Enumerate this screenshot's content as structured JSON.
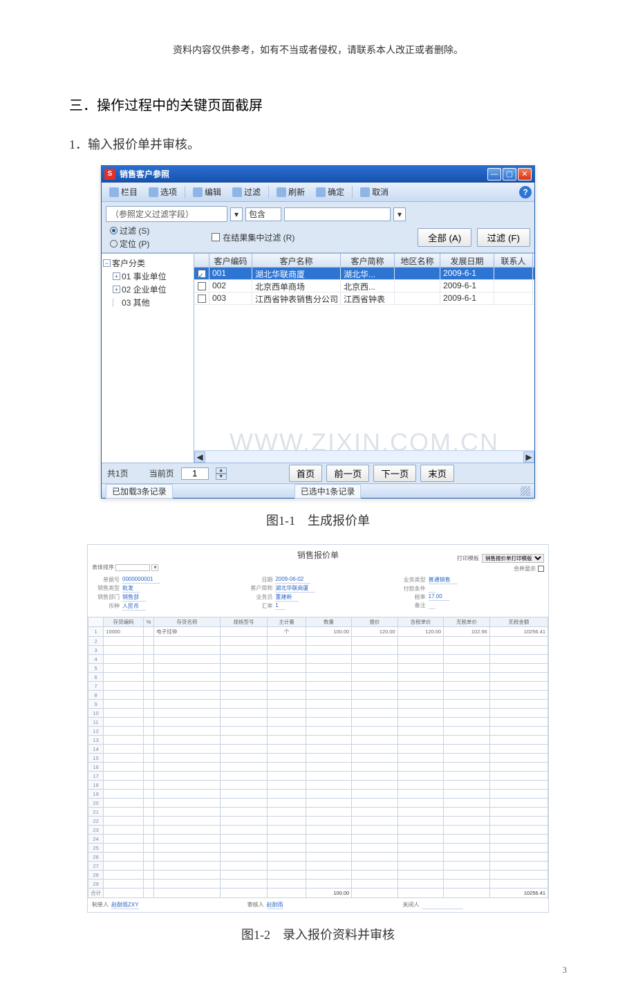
{
  "page": {
    "disclaimer": "资料内容仅供参考，如有不当或者侵权，请联系本人改正或者删除。",
    "section_title": "三．操作过程中的关键页面截屏",
    "subsection": "1．输入报价单并审核。",
    "caption1": "图1-1　生成报价单",
    "caption2": "图1-2　录入报价资料并审核",
    "page_number": "3",
    "watermark": "WWW.ZIXIN.COM.CN"
  },
  "window1": {
    "title": "销售客户参照",
    "toolbar": {
      "columns": "栏目",
      "options": "选项",
      "edit": "编辑",
      "filter": "过滤",
      "refresh": "刷新",
      "confirm": "确定",
      "cancel": "取消"
    },
    "filterbar": {
      "field_placeholder": "（参照定义过滤字段）",
      "contains": "包含",
      "in_results": "在结果集中过滤 (R)",
      "radio_filter": "过滤 (S)",
      "radio_locate": "定位 (P)",
      "btn_all": "全部 (A)",
      "btn_filter": "过滤 (F)"
    },
    "tree": {
      "root": "客户分类",
      "n1": "01 事业单位",
      "n2": "02 企业单位",
      "n3": "03 其他"
    },
    "grid": {
      "h_code": "客户编码",
      "h_name": "客户名称",
      "h_short": "客户简称",
      "h_region": "地区名称",
      "h_date": "发展日期",
      "h_contact": "联系人",
      "rows": [
        {
          "chk": true,
          "code": "001",
          "name": "湖北华联商厦",
          "short": "湖北华...",
          "region": "",
          "date": "2009-6-1",
          "contact": ""
        },
        {
          "chk": false,
          "code": "002",
          "name": "北京西单商场",
          "short": "北京西...",
          "region": "",
          "date": "2009-6-1",
          "contact": ""
        },
        {
          "chk": false,
          "code": "003",
          "name": "江西省钟表销售分公司",
          "short": "江西省钟表",
          "region": "",
          "date": "2009-6-1",
          "contact": ""
        }
      ]
    },
    "pager": {
      "total": "共1页",
      "current_label": "当前页",
      "current_value": "1",
      "first": "首页",
      "prev": "前一页",
      "next": "下一页",
      "last": "末页"
    },
    "status": {
      "loaded": "已加载3条记录",
      "selected": "已选中1条记录"
    }
  },
  "form2": {
    "title": "销售报价单",
    "top_left_label": "表体排序",
    "top_right_label": "打印模板",
    "top_right_value": "销售报价单打印模版",
    "merge_label": "合并显示",
    "meta_left": {
      "bill_no_lbl": "单据号",
      "bill_no": "0000000001",
      "sale_type_lbl": "销售类型",
      "sale_type": "批发",
      "dept_lbl": "销售部门",
      "dept": "销售部",
      "currency_lbl": "币种",
      "currency": "人民币"
    },
    "meta_mid": {
      "date_lbl": "日期",
      "date": "2009-06-02",
      "cust_lbl": "客户简称",
      "cust": "湖北华联商厦",
      "rep_lbl": "业务员",
      "rep": "董建新",
      "rate_lbl": "汇率",
      "rate": "1"
    },
    "meta_right": {
      "biz_lbl": "业务类型",
      "biz": "普通销售",
      "pay_lbl": "付款条件",
      "pay": "",
      "tax_lbl": "税率",
      "tax": "17.00",
      "remark_lbl": "备注",
      "remark": ""
    },
    "grid": {
      "h_inv_code": "存货编码",
      "h_inv_scale": "%",
      "h_inv_name": "存货名称",
      "h_spec": "规格型号",
      "h_unit": "主计量",
      "h_qty": "数量",
      "h_price": "报价",
      "h_taxedprice": "含税单价",
      "h_untaxedprice": "无税单价",
      "h_untaxedamt": "无税金额",
      "row": {
        "inv_code": "10000",
        "inv_name": "电子挂钟",
        "unit": "个",
        "qty": "100.00",
        "price": "120.00",
        "taxedprice": "120.00",
        "untaxedprice": "102.56",
        "untaxedamt": "10256.41"
      },
      "sum_row_label": "合计",
      "sum_qty": "100.00",
      "sum_amt": "10256.41"
    },
    "footer": {
      "maker_lbl": "制单人",
      "maker": "赵耐雨ZXY",
      "auditor_lbl": "审核人",
      "auditor": "赵耐雨",
      "closer_lbl": "关闭人",
      "closer": ""
    }
  }
}
